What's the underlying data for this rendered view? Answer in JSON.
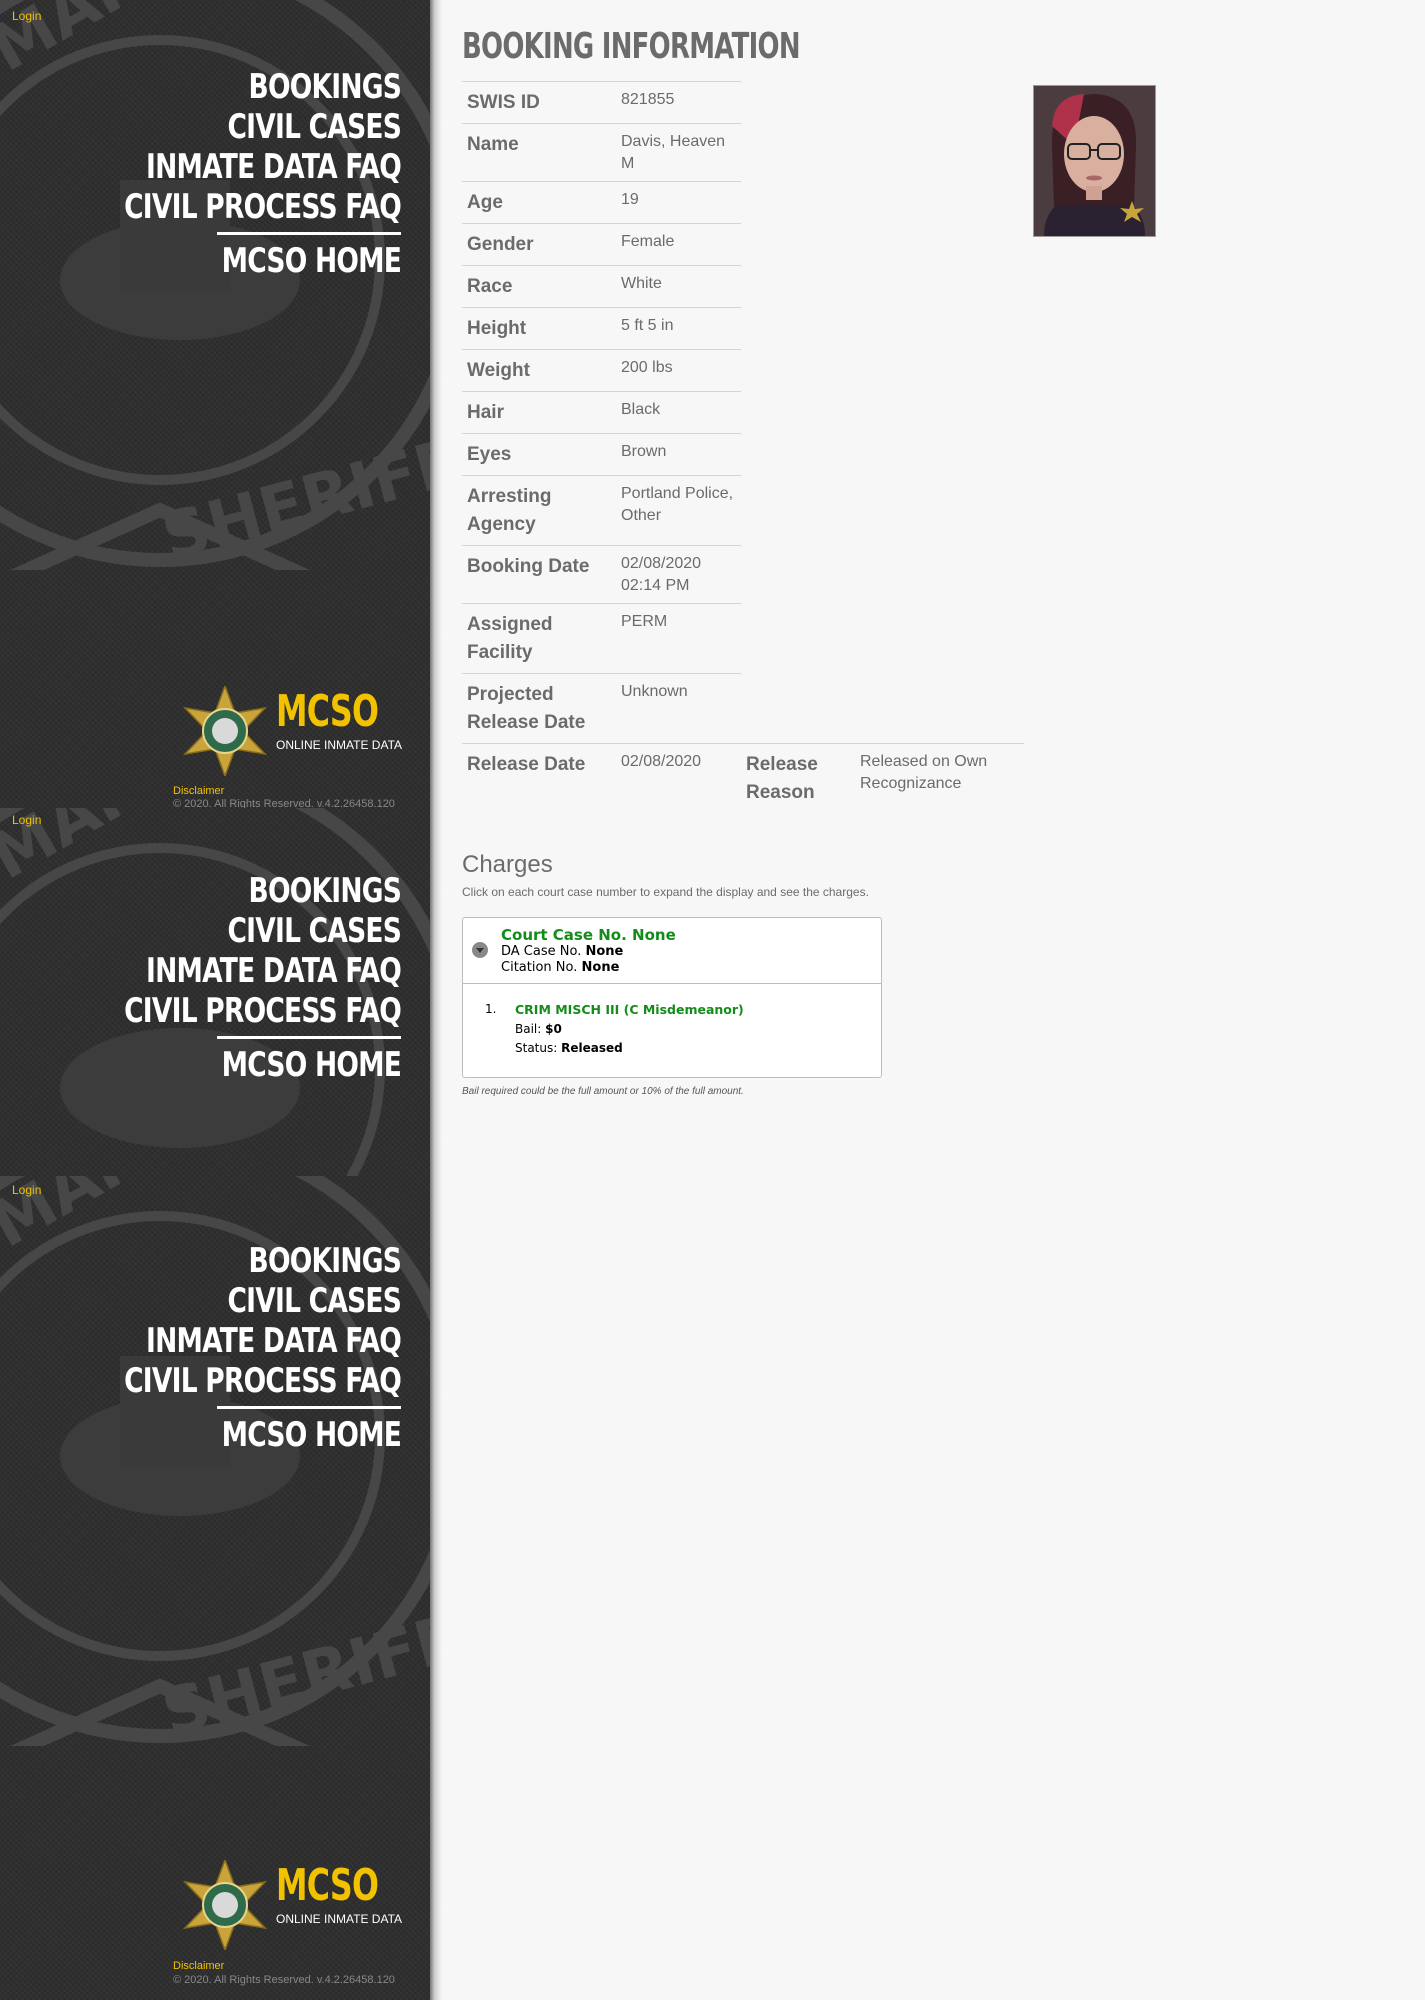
{
  "sidebar": {
    "login": "Login",
    "nav": [
      "BOOKINGS",
      "CIVIL CASES",
      "INMATE DATA FAQ",
      "CIVIL PROCESS FAQ"
    ],
    "home": "MCSO HOME",
    "brand": "MCSO",
    "brand_sub": "ONLINE INMATE DATA",
    "disclaimer": "Disclaimer",
    "copyright": "© 2020. All Rights Reserved.    v.4.2.26458.120",
    "accent_color": "#f2c200"
  },
  "booking": {
    "title": "BOOKING INFORMATION",
    "fields": [
      {
        "label": "SWIS ID",
        "value": "821855"
      },
      {
        "label": "Name",
        "value": "Davis, Heaven M"
      },
      {
        "label": "Age",
        "value": "19"
      },
      {
        "label": "Gender",
        "value": "Female"
      },
      {
        "label": "Race",
        "value": "White"
      },
      {
        "label": "Height",
        "value": "5 ft 5 in"
      },
      {
        "label": "Weight",
        "value": "200 lbs"
      },
      {
        "label": "Hair",
        "value": "Black"
      },
      {
        "label": "Eyes",
        "value": "Brown"
      },
      {
        "label": "Arresting Agency",
        "value": "Portland Police, Other"
      },
      {
        "label": "Booking Date",
        "value": "02/08/2020 02:14 PM"
      },
      {
        "label": "Assigned Facility",
        "value": "PERM"
      },
      {
        "label": "Projected Release Date",
        "value": "Unknown"
      },
      {
        "label": "Release Date",
        "value": "02/08/2020"
      }
    ],
    "release_reason": {
      "label": "Release Reason",
      "value": "Released on Own Recognizance"
    }
  },
  "charges": {
    "title": "Charges",
    "hint": "Click on each court case number to expand the display and see the charges.",
    "case": {
      "court_label": "Court Case No.",
      "court_value": "None",
      "da_label": "DA Case No.",
      "da_value": "None",
      "citation_label": "Citation No.",
      "citation_value": "None"
    },
    "items": [
      {
        "num": "1.",
        "name": "CRIM MISCH III (C Misdemeanor)",
        "bail_label": "Bail:",
        "bail": "$0",
        "status_label": "Status:",
        "status": "Released"
      }
    ],
    "note": "Bail required could be the full amount or 10% of the full amount.",
    "link_color": "#138c1a"
  }
}
